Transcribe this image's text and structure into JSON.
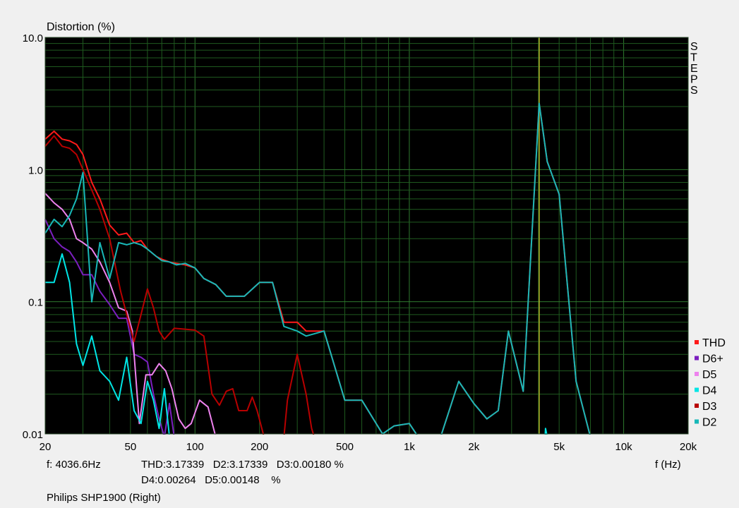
{
  "chart_data": {
    "type": "line",
    "title": "",
    "ylabel": "Distortion (%)",
    "xlabel": "f (Hz)",
    "x_scale": "log",
    "y_scale": "log",
    "xlim": [
      20,
      20000
    ],
    "ylim": [
      0.01,
      10.0
    ],
    "x_tick_labels": [
      {
        "value": 20,
        "label": "20"
      },
      {
        "value": 50,
        "label": "50"
      },
      {
        "value": 100,
        "label": "100"
      },
      {
        "value": 200,
        "label": "200"
      },
      {
        "value": 500,
        "label": "500"
      },
      {
        "value": 1000,
        "label": "1k"
      },
      {
        "value": 2000,
        "label": "2k"
      },
      {
        "value": 5000,
        "label": "5k"
      },
      {
        "value": 10000,
        "label": "10k"
      },
      {
        "value": 20000,
        "label": "20k"
      }
    ],
    "y_tick_labels": [
      {
        "value": 10,
        "label": "10.0"
      },
      {
        "value": 1,
        "label": "1.0"
      },
      {
        "value": 0.1,
        "label": "0.1"
      },
      {
        "value": 0.01,
        "label": "0.01"
      }
    ],
    "grid": true,
    "legend_position": "bottom-right",
    "side_label": "STEPS",
    "cursor": {
      "x": 4036.6,
      "color": "#b5b52a"
    },
    "series": [
      {
        "name": "D6+",
        "color": "#7b1fbf",
        "points": [
          [
            20,
            0.42
          ],
          [
            22,
            0.3
          ],
          [
            24,
            0.26
          ],
          [
            26,
            0.24
          ],
          [
            28,
            0.2
          ],
          [
            30,
            0.16
          ],
          [
            33,
            0.16
          ],
          [
            36,
            0.12
          ],
          [
            40,
            0.095
          ],
          [
            44,
            0.075
          ],
          [
            48,
            0.075
          ],
          [
            52,
            0.04
          ],
          [
            56,
            0.038
          ],
          [
            60,
            0.035
          ],
          [
            64,
            0.02
          ],
          [
            68,
            0.013
          ],
          [
            72,
            0.0095
          ],
          [
            76,
            0.017
          ],
          [
            80,
            0.0095
          ]
        ]
      },
      {
        "name": "D5",
        "color": "#ee82ee",
        "points": [
          [
            20,
            0.66
          ],
          [
            22,
            0.56
          ],
          [
            24,
            0.5
          ],
          [
            26,
            0.42
          ],
          [
            28,
            0.3
          ],
          [
            30,
            0.28
          ],
          [
            33,
            0.25
          ],
          [
            36,
            0.2
          ],
          [
            40,
            0.14
          ],
          [
            44,
            0.09
          ],
          [
            48,
            0.085
          ],
          [
            51,
            0.06
          ],
          [
            55,
            0.012
          ],
          [
            59,
            0.028
          ],
          [
            63,
            0.028
          ],
          [
            68,
            0.034
          ],
          [
            73,
            0.03
          ],
          [
            78,
            0.022
          ],
          [
            84,
            0.013
          ],
          [
            90,
            0.011
          ],
          [
            96,
            0.012
          ],
          [
            105,
            0.018
          ],
          [
            115,
            0.016
          ],
          [
            125,
            0.0095
          ]
        ]
      },
      {
        "name": "D3",
        "color": "#b80000",
        "points": [
          [
            20,
            1.5
          ],
          [
            22,
            1.8
          ],
          [
            24,
            1.5
          ],
          [
            26,
            1.45
          ],
          [
            28,
            1.3
          ],
          [
            30,
            1.0
          ],
          [
            33,
            0.7
          ],
          [
            36,
            0.5
          ],
          [
            40,
            0.3
          ],
          [
            45,
            0.12
          ],
          [
            48,
            0.08
          ],
          [
            52,
            0.05
          ],
          [
            56,
            0.08
          ],
          [
            60,
            0.125
          ],
          [
            64,
            0.09
          ],
          [
            68,
            0.06
          ],
          [
            72,
            0.052
          ],
          [
            80,
            0.063
          ],
          [
            90,
            0.062
          ],
          [
            100,
            0.061
          ],
          [
            110,
            0.055
          ],
          [
            120,
            0.02
          ],
          [
            130,
            0.0165
          ],
          [
            140,
            0.021
          ],
          [
            150,
            0.022
          ],
          [
            160,
            0.015
          ],
          [
            175,
            0.015
          ],
          [
            185,
            0.019
          ],
          [
            195,
            0.015
          ],
          [
            210,
            0.0095
          ],
          [
            250,
            0.0095
          ],
          [
            260,
            0.0095
          ],
          [
            270,
            0.018
          ],
          [
            300,
            0.04
          ],
          [
            330,
            0.02
          ],
          [
            350,
            0.011
          ],
          [
            360,
            0.0095
          ]
        ]
      },
      {
        "name": "THD",
        "color": "#ff1a1a",
        "points": [
          [
            20,
            1.7
          ],
          [
            22,
            1.95
          ],
          [
            24,
            1.7
          ],
          [
            26,
            1.65
          ],
          [
            28,
            1.55
          ],
          [
            30,
            1.3
          ],
          [
            33,
            0.8
          ],
          [
            36,
            0.6
          ],
          [
            40,
            0.38
          ],
          [
            44,
            0.32
          ],
          [
            48,
            0.33
          ],
          [
            52,
            0.28
          ],
          [
            56,
            0.29
          ],
          [
            60,
            0.25
          ],
          [
            66,
            0.22
          ],
          [
            70,
            0.21
          ],
          [
            76,
            0.2
          ],
          [
            82,
            0.195
          ],
          [
            90,
            0.19
          ],
          [
            100,
            0.18
          ],
          [
            110,
            0.15
          ],
          [
            125,
            0.135
          ],
          [
            140,
            0.11
          ],
          [
            155,
            0.11
          ],
          [
            170,
            0.11
          ],
          [
            200,
            0.14
          ],
          [
            230,
            0.14
          ],
          [
            260,
            0.07
          ],
          [
            300,
            0.07
          ],
          [
            330,
            0.06
          ],
          [
            400,
            0.06
          ],
          [
            500,
            0.018
          ],
          [
            600,
            0.018
          ],
          [
            750,
            0.01
          ],
          [
            850,
            0.0115
          ],
          [
            1000,
            0.012
          ],
          [
            1100,
            0.0095
          ],
          [
            1400,
            0.0095
          ],
          [
            1700,
            0.025
          ],
          [
            2000,
            0.017
          ],
          [
            2300,
            0.013
          ],
          [
            2600,
            0.015
          ],
          [
            2900,
            0.06
          ],
          [
            3400,
            0.021
          ],
          [
            4036.6,
            3.17
          ],
          [
            4400,
            1.15
          ],
          [
            5000,
            0.65
          ],
          [
            6000,
            0.025
          ],
          [
            7000,
            0.0095
          ]
        ]
      },
      {
        "name": "D4",
        "color": "#00e5e5",
        "points": [
          [
            20,
            0.14
          ],
          [
            22,
            0.14
          ],
          [
            24,
            0.23
          ],
          [
            26,
            0.14
          ],
          [
            28,
            0.048
          ],
          [
            30,
            0.033
          ],
          [
            33,
            0.055
          ],
          [
            36,
            0.03
          ],
          [
            40,
            0.025
          ],
          [
            44,
            0.018
          ],
          [
            48,
            0.038
          ],
          [
            52,
            0.015
          ],
          [
            56,
            0.012
          ],
          [
            60,
            0.025
          ],
          [
            64,
            0.018
          ],
          [
            68,
            0.011
          ],
          [
            72,
            0.022
          ],
          [
            76,
            0.0095
          ],
          [
            4300,
            0.0095
          ],
          [
            4320,
            0.011
          ],
          [
            4400,
            0.0095
          ]
        ]
      },
      {
        "name": "D2",
        "color": "#18b8b8",
        "points": [
          [
            20,
            0.33
          ],
          [
            22,
            0.42
          ],
          [
            24,
            0.37
          ],
          [
            26,
            0.45
          ],
          [
            28,
            0.6
          ],
          [
            30,
            0.95
          ],
          [
            33,
            0.1
          ],
          [
            36,
            0.28
          ],
          [
            40,
            0.15
          ],
          [
            44,
            0.28
          ],
          [
            48,
            0.27
          ],
          [
            52,
            0.28
          ],
          [
            56,
            0.27
          ],
          [
            60,
            0.25
          ],
          [
            66,
            0.22
          ],
          [
            70,
            0.205
          ],
          [
            76,
            0.2
          ],
          [
            82,
            0.19
          ],
          [
            90,
            0.195
          ],
          [
            100,
            0.18
          ],
          [
            110,
            0.15
          ],
          [
            125,
            0.135
          ],
          [
            140,
            0.11
          ],
          [
            155,
            0.11
          ],
          [
            170,
            0.11
          ],
          [
            200,
            0.14
          ],
          [
            230,
            0.14
          ],
          [
            260,
            0.065
          ],
          [
            300,
            0.06
          ],
          [
            330,
            0.055
          ],
          [
            400,
            0.06
          ],
          [
            500,
            0.018
          ],
          [
            600,
            0.018
          ],
          [
            750,
            0.01
          ],
          [
            850,
            0.0115
          ],
          [
            1000,
            0.012
          ],
          [
            1100,
            0.0095
          ],
          [
            1400,
            0.0095
          ],
          [
            1700,
            0.025
          ],
          [
            2000,
            0.017
          ],
          [
            2300,
            0.013
          ],
          [
            2600,
            0.015
          ],
          [
            2900,
            0.06
          ],
          [
            3400,
            0.021
          ],
          [
            4036.6,
            3.17
          ],
          [
            4400,
            1.15
          ],
          [
            5000,
            0.65
          ],
          [
            6000,
            0.025
          ],
          [
            7000,
            0.0095
          ]
        ]
      }
    ],
    "legend": [
      {
        "name": "THD",
        "color": "#ff1a1a"
      },
      {
        "name": "D6+",
        "color": "#7b1fbf"
      },
      {
        "name": "D5",
        "color": "#ee82ee"
      },
      {
        "name": "D4",
        "color": "#00e5e5"
      },
      {
        "name": "D3",
        "color": "#b80000"
      },
      {
        "name": "D2",
        "color": "#18b8b8"
      }
    ]
  },
  "readout": {
    "f": "f: 4036.6Hz",
    "line1": "THD:3.17339   D2:3.17339   D3:0.00180 %",
    "line2": "D4:0.00264   D5:0.00148    %"
  },
  "caption": "Philips SHP1900 (Right)"
}
